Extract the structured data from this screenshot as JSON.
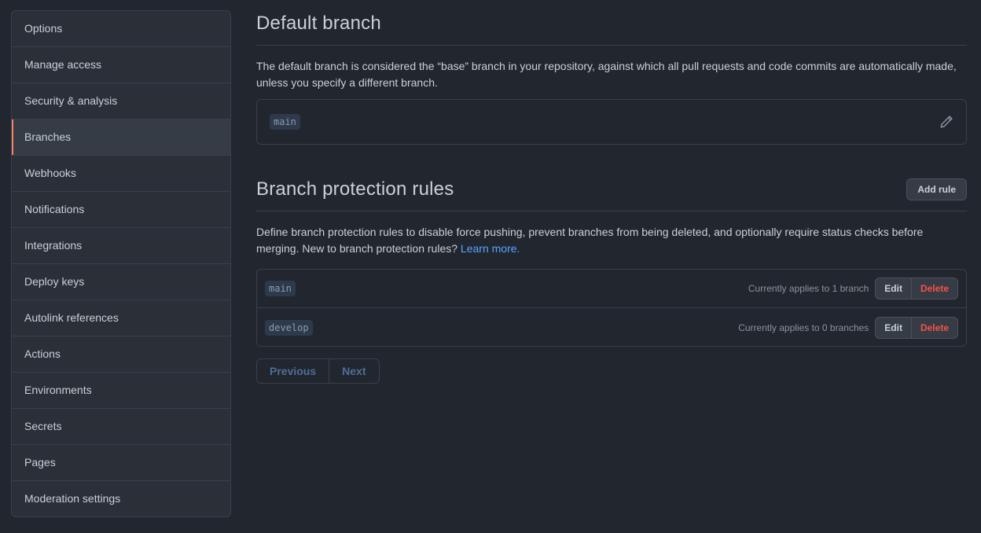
{
  "sidebar": {
    "items": [
      {
        "label": "Options"
      },
      {
        "label": "Manage access"
      },
      {
        "label": "Security & analysis"
      },
      {
        "label": "Branches"
      },
      {
        "label": "Webhooks"
      },
      {
        "label": "Notifications"
      },
      {
        "label": "Integrations"
      },
      {
        "label": "Deploy keys"
      },
      {
        "label": "Autolink references"
      },
      {
        "label": "Actions"
      },
      {
        "label": "Environments"
      },
      {
        "label": "Secrets"
      },
      {
        "label": "Pages"
      },
      {
        "label": "Moderation settings"
      }
    ],
    "active": "Branches"
  },
  "default_branch": {
    "title": "Default branch",
    "description": "The default branch is considered the “base” branch in your repository, against which all pull requests and code commits are automatically made, unless you specify a different branch.",
    "branch": "main",
    "edit_icon": "pencil-icon"
  },
  "protection": {
    "title": "Branch protection rules",
    "add_label": "Add rule",
    "description": "Define branch protection rules to disable force pushing, prevent branches from being deleted, and optionally require status checks before merging. New to branch protection rules?",
    "learn_more": "Learn more.",
    "rules": [
      {
        "pattern": "main",
        "applies": "Currently applies to 1 branch",
        "edit": "Edit",
        "delete": "Delete"
      },
      {
        "pattern": "develop",
        "applies": "Currently applies to 0 branches",
        "edit": "Edit",
        "delete": "Delete"
      }
    ]
  },
  "pagination": {
    "previous": "Previous",
    "next": "Next"
  },
  "colors": {
    "accent": "#f78166",
    "link": "#58a6ff",
    "danger": "#f85149",
    "background": "#22262e"
  }
}
